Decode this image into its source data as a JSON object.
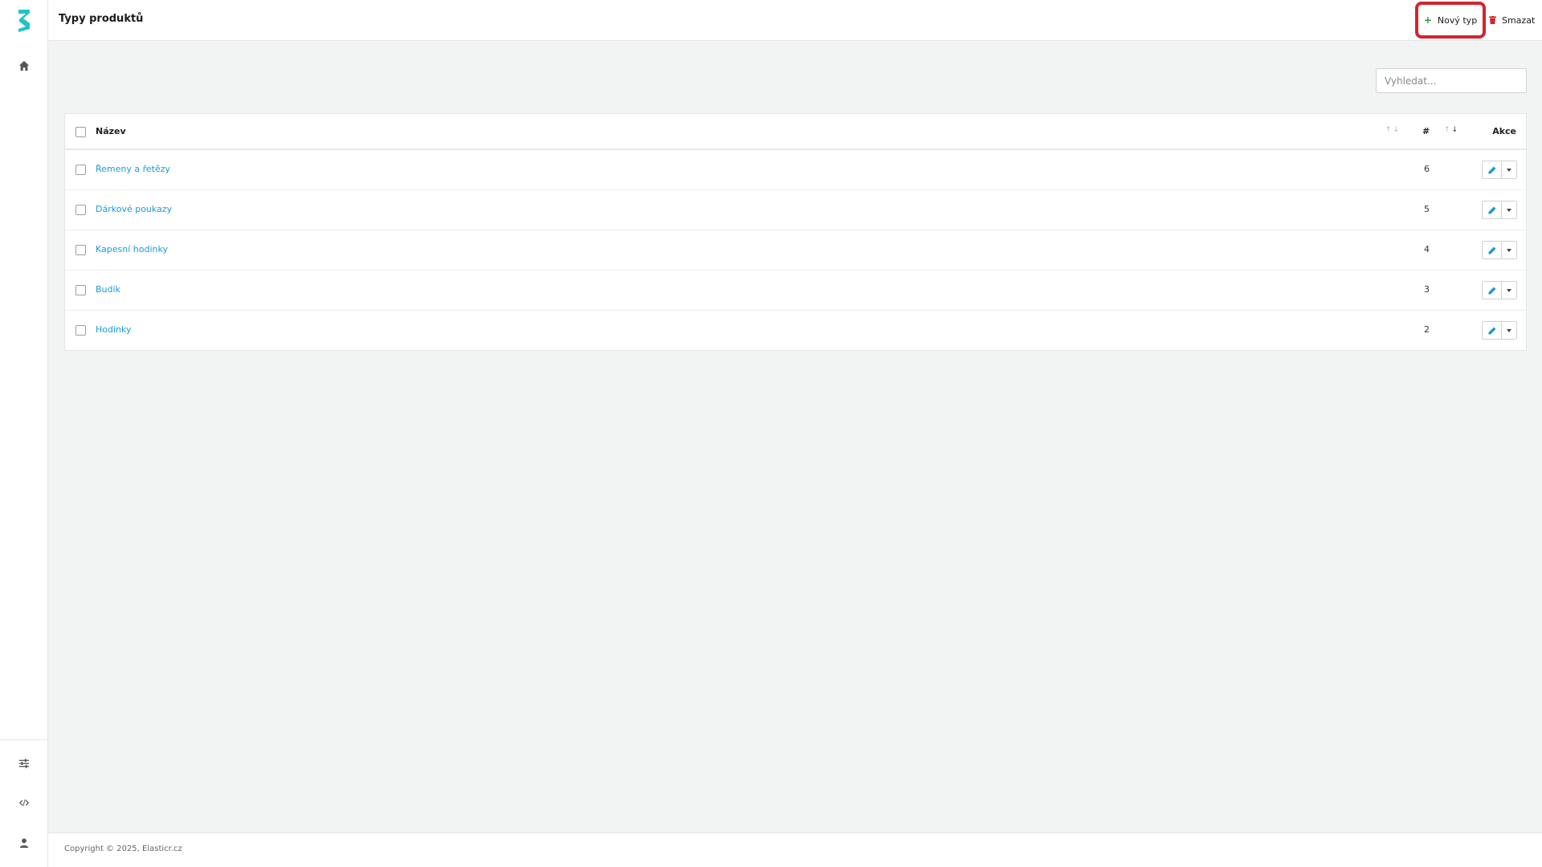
{
  "header": {
    "title": "Typy produktů",
    "new_label": "Nový typ",
    "delete_label": "Smazat"
  },
  "search": {
    "placeholder": "Vyhledat...",
    "value": ""
  },
  "table": {
    "col_name": "Název",
    "col_count": "#",
    "col_actions": "Akce",
    "rows": [
      {
        "name": "Řemeny a řetězy",
        "count": "6"
      },
      {
        "name": "Dárkové poukazy",
        "count": "5"
      },
      {
        "name": "Kapesní hodinky",
        "count": "4"
      },
      {
        "name": "Budík",
        "count": "3"
      },
      {
        "name": "Hodinky",
        "count": "2"
      }
    ]
  },
  "footer": {
    "copyright": "Copyright © 2025, Elasticr.cz"
  },
  "colors": {
    "accent": "#1a9bd7",
    "brand": "#1fc4c4",
    "highlight": "#d0262e",
    "add": "#2e9a3b"
  },
  "icons": [
    "logo-icon",
    "home-icon",
    "sliders-icon",
    "code-icon",
    "user-icon",
    "trash-icon",
    "pencil-icon"
  ]
}
